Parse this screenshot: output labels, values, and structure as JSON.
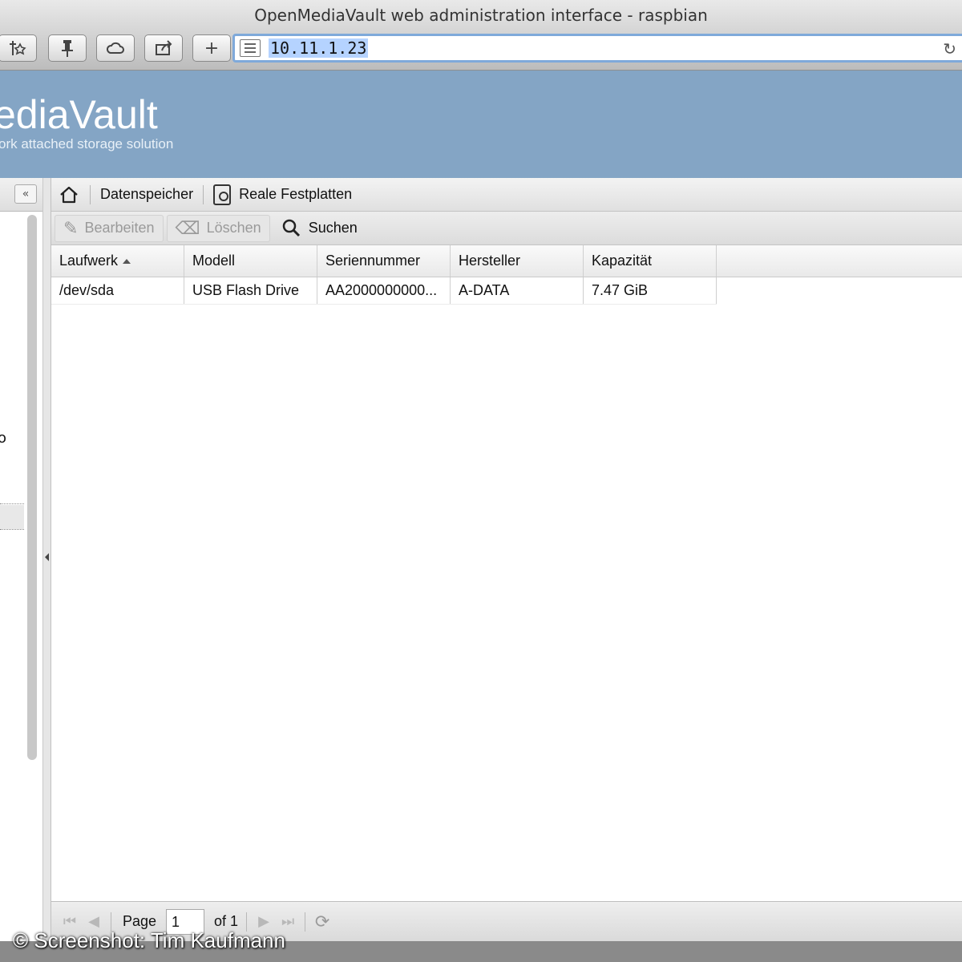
{
  "window": {
    "title": "OpenMediaVault web administration interface - raspbian"
  },
  "browser": {
    "url": "10.11.1.23",
    "buttons": [
      {
        "name": "new-tab-button",
        "icon": "plus-icon",
        "label": "+"
      }
    ]
  },
  "app": {
    "logo_title": "ediaVault",
    "logo_subtitle": "ork attached storage solution"
  },
  "left_panel": {
    "collapse_label": "«",
    "fragment_text": "o"
  },
  "breadcrumb": {
    "items": [
      {
        "label": "Datenspeicher"
      },
      {
        "label": "Reale Festplatten"
      }
    ]
  },
  "actions": {
    "edit": "Bearbeiten",
    "delete": "Löschen",
    "search": "Suchen"
  },
  "grid": {
    "columns": [
      "Laufwerk",
      "Modell",
      "Seriennummer",
      "Hersteller",
      "Kapazität"
    ],
    "rows": [
      [
        "/dev/sda",
        "USB Flash Drive",
        "AA2000000000...",
        "A-DATA",
        "7.47 GiB"
      ]
    ]
  },
  "paging": {
    "page_label": "Page",
    "current_page": "1",
    "of_label": "of 1"
  },
  "watermark": "© Screenshot: Tim Kaufmann",
  "colors": {
    "header_bg": "#84a5c5",
    "url_highlight": "#b5d3ff"
  }
}
